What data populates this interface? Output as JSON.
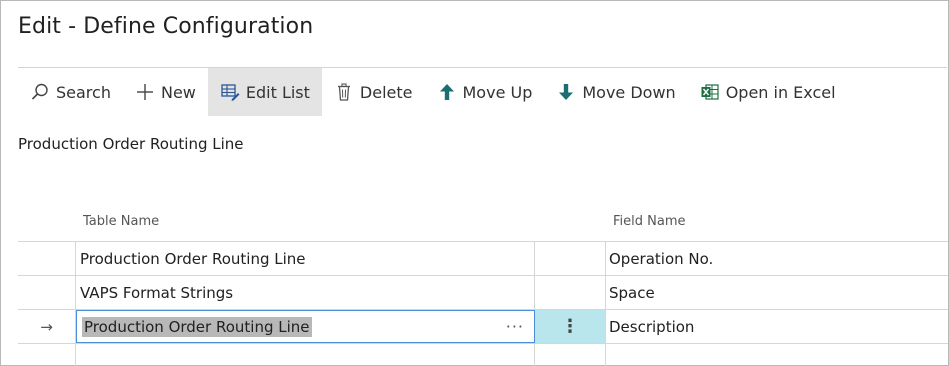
{
  "page": {
    "title": "Edit - Define Configuration",
    "subtitle": "Production Order Routing Line"
  },
  "toolbar": {
    "search": "Search",
    "new": "New",
    "edit_list": "Edit List",
    "delete": "Delete",
    "move_up": "Move Up",
    "move_down": "Move Down",
    "open_in_excel": "Open in Excel"
  },
  "columns": {
    "table_name": "Table Name",
    "field_name": "Field Name"
  },
  "rows": [
    {
      "indicator": "",
      "table_name": "Production Order Routing Line",
      "field_name": "Operation No."
    },
    {
      "indicator": "",
      "table_name": "VAPS Format Strings",
      "field_name": "Space"
    },
    {
      "indicator": "→",
      "table_name": "Production Order Routing Line",
      "field_name": "Description",
      "editing": true
    }
  ],
  "edit_cell": {
    "lookup_glyph": "···",
    "menu_glyph": "⋮"
  },
  "colors": {
    "accent": "#4a90d9",
    "focus_cell": "#b9e6ec",
    "active_button": "#e4e4e4",
    "selection": "#b8b8b8"
  }
}
